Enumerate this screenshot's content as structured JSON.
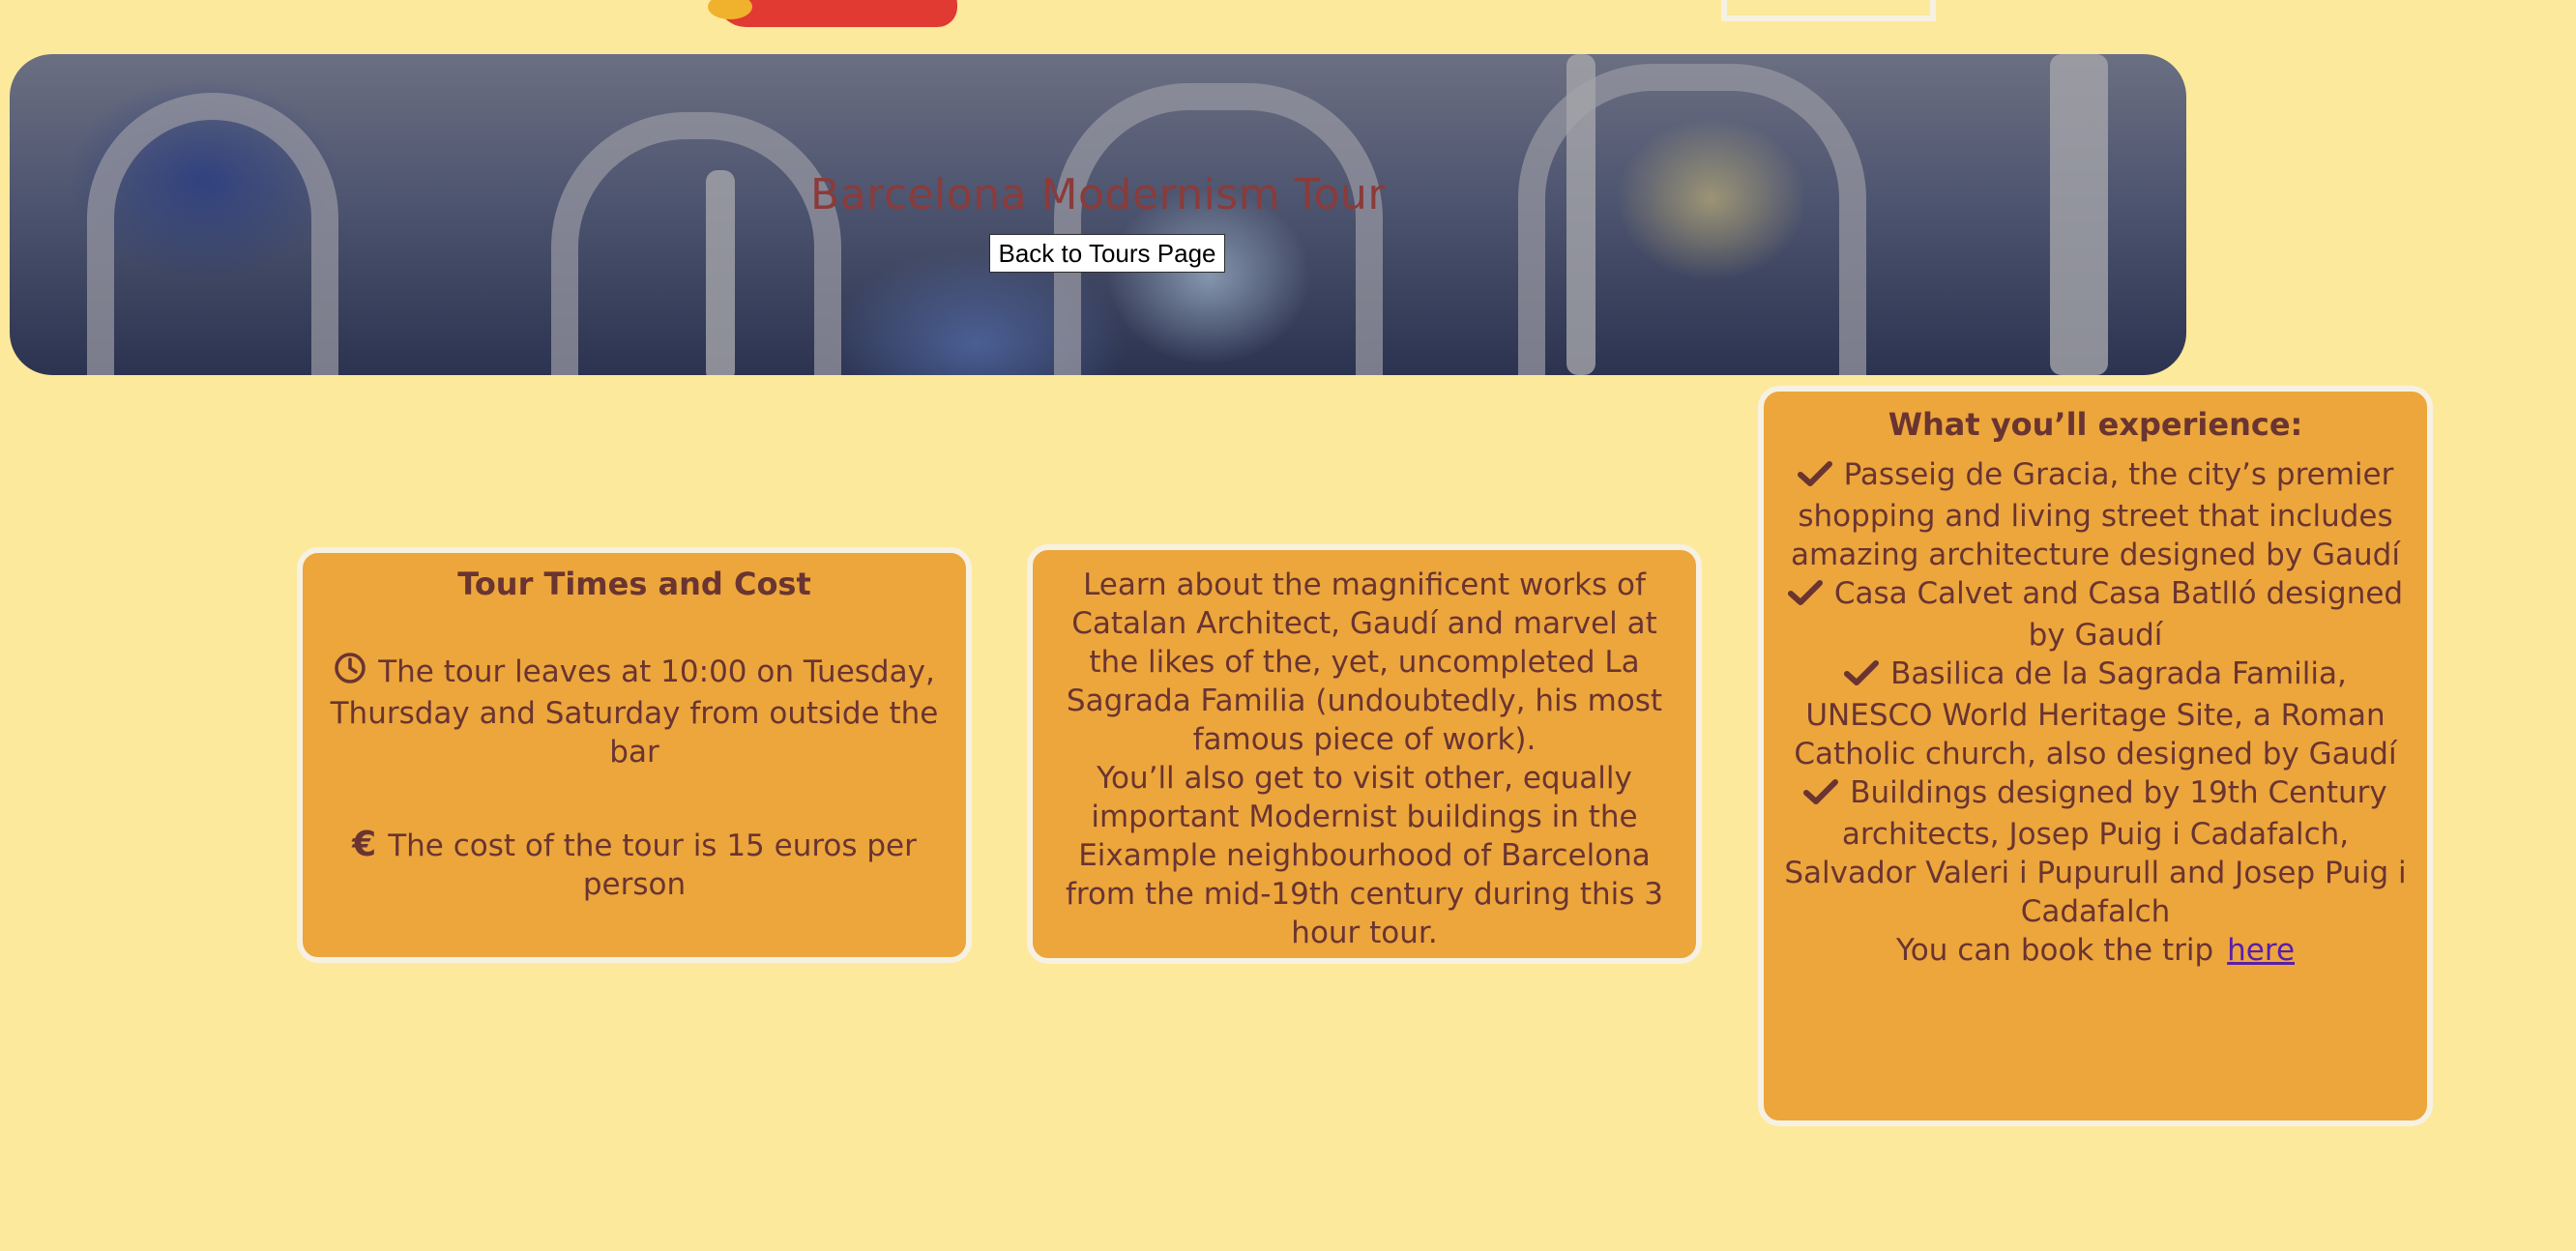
{
  "page": {
    "title": "Barcelona Modernism Tour",
    "back_button_label": "Back to Tours Page"
  },
  "times_card": {
    "heading": "Tour Times and Cost",
    "time_icon": "clock-icon",
    "time_text": "The tour leaves at 10:00 on Tuesday, Thursday and Saturday from outside the bar",
    "cost_icon": "euro-icon",
    "cost_text": "The cost of the tour is 15 euros per person"
  },
  "description_card": {
    "paragraph1": "Learn about the magnificent works of Catalan Architect, Gaudí and marvel at the likes of the, yet, uncompleted La Sagrada Familia (undoubtedly, his most famous piece of work).",
    "paragraph2": "You’ll also get to visit other, equally important Modernist buildings in the Eixample neighbourhood of Barcelona from the mid-19th century during this 3 hour tour."
  },
  "experience_card": {
    "heading": "What you’ll experience:",
    "item_icon": "check-icon",
    "items": [
      "Passeig de Gracia, the city’s premier shopping and living street that includes amazing architecture designed by Gaudí",
      "Casa Calvet and Casa Batlló designed by Gaudí",
      "Basilica de la Sagrada Familia, UNESCO World Heritage Site, a Roman Catholic church, also designed by Gaudí",
      "Buildings designed by 19th Century architects, Josep Puig i Cadafalch, Salvador Valeri i Pupurull and Josep Puig i Cadafalch"
    ],
    "book_text": "You can book the trip",
    "book_link": "here"
  },
  "colors": {
    "background": "#fde99b",
    "card": "#eca63c",
    "card_border": "#f7f1e2",
    "text": "#6a3431",
    "title": "#8a3b3a",
    "link": "#5a1fa8"
  }
}
